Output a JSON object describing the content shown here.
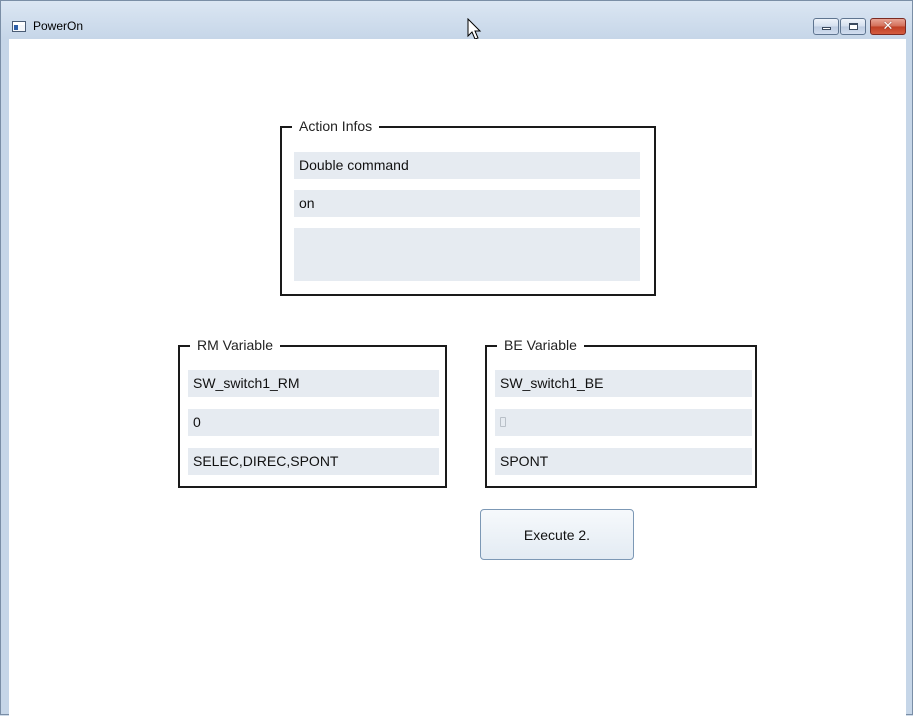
{
  "window": {
    "title": "PowerOn",
    "app_icon": "window-app-icon",
    "caption": {
      "minimize_icon": "minimize-icon",
      "maximize_icon": "maximize-icon",
      "close_icon": "close-icon",
      "close_glyph": "✕"
    }
  },
  "action_infos": {
    "label": "Action Infos",
    "fields": [
      "Double command",
      "on",
      ""
    ]
  },
  "rm_variable": {
    "label": "RM Variable",
    "fields": [
      "SW_switch1_RM",
      "0",
      "SELEC,DIREC,SPONT"
    ]
  },
  "be_variable": {
    "label": "BE Variable",
    "fields": [
      "SW_switch1_BE",
      "",
      "SPONT"
    ]
  },
  "execute_button": {
    "label": "Execute 2."
  },
  "colors": {
    "field_background": "#e6ebf1",
    "group_border": "#1a1a1a",
    "title_bar": "#dbe6f3"
  }
}
